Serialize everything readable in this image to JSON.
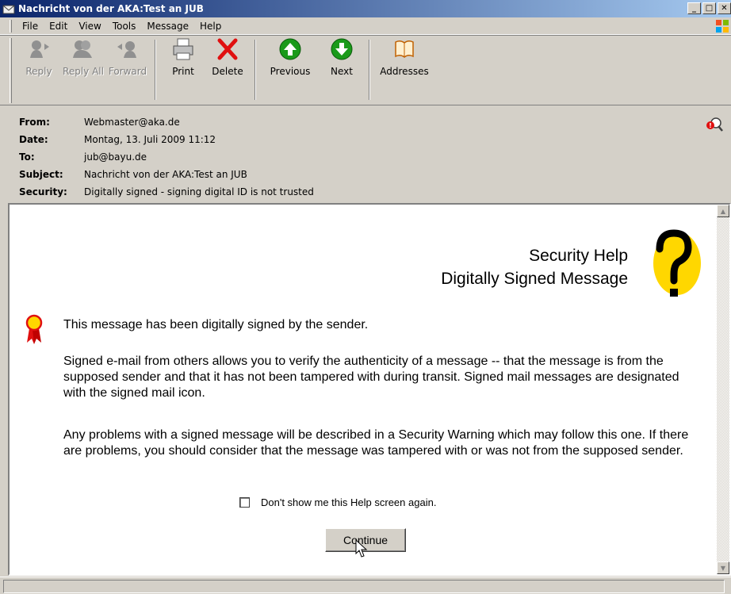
{
  "window": {
    "title": "Nachricht von der AKA:Test an JUB"
  },
  "menu": [
    "File",
    "Edit",
    "View",
    "Tools",
    "Message",
    "Help"
  ],
  "toolbar": {
    "reply": "Reply",
    "reply_all": "Reply All",
    "forward": "Forward",
    "print": "Print",
    "delete": "Delete",
    "previous": "Previous",
    "next": "Next",
    "addresses": "Addresses"
  },
  "headers": {
    "from_label": "From:",
    "from": "Webmaster@aka.de",
    "date_label": "Date:",
    "date": "Montag, 13. Juli 2009 11:12",
    "to_label": "To:",
    "to": "jub@bayu.de",
    "subject_label": "Subject:",
    "subject": "Nachricht von der AKA:Test an JUB",
    "security_label": "Security:",
    "security": "Digitally signed - signing digital ID is not trusted"
  },
  "help": {
    "title_line1": "Security Help",
    "title_line2": "Digitally Signed Message",
    "intro": "This message has been digitally signed by the sender.",
    "para1": "Signed e-mail from others allows you to verify the authenticity of a message -- that the message is from the supposed sender and that it has not been tampered with during transit. Signed mail messages are designated with the signed mail icon.",
    "para2": "Any problems with a signed message will be described in a Security Warning which may follow this one. If there are problems, you should consider that the message was tampered with or was not from the supposed sender.",
    "dont_show": "Don't show me this Help screen again.",
    "continue": "Continue"
  },
  "icons": {
    "accent_red": "#e01010",
    "accent_green": "#1a9a1a",
    "help_yellow": "#ffd700"
  }
}
